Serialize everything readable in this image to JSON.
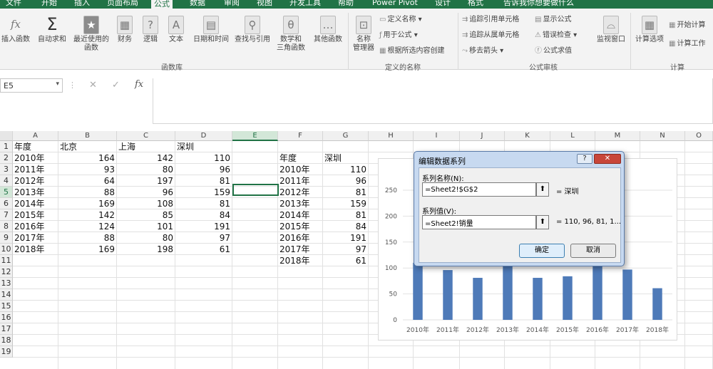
{
  "ribbon_tabs": [
    "文件",
    "开始",
    "插入",
    "页面布局",
    "公式",
    "数据",
    "审阅",
    "视图",
    "开发工具",
    "帮助",
    "Power Pivot",
    "设计",
    "格式",
    "告诉我你想要做什么"
  ],
  "ribbon": {
    "insert_function": "插入函数",
    "autosum": "自动求和",
    "recent": "最近使用的",
    "recent2": "函数",
    "financial": "财务",
    "logical": "逻辑",
    "text": "文本",
    "datetime": "日期和时间",
    "lookup": "查找与引用",
    "math": "数学和",
    "math2": "三角函数",
    "more": "其他函数",
    "group_library": "函数库",
    "name_manager": "名称",
    "name_manager2": "管理器",
    "define_name": "定义名称",
    "use_in_formula": "用于公式",
    "create_from_sel": "根据所选内容创建",
    "group_names": "定义的名称",
    "trace_prec": "追踪引用单元格",
    "trace_dep": "追踪从属单元格",
    "remove_arrows": "移去箭头",
    "show_formulas": "显示公式",
    "error_check": "错误检查",
    "evaluate": "公式求值",
    "watch": "监视窗口",
    "group_audit": "公式审核",
    "calc_options": "计算选项",
    "calc_now": "开始计算",
    "calc_sheet": "计算工作",
    "group_calc": "计算"
  },
  "formula_bar": {
    "namebox": "E5",
    "fx": "fx",
    "cancel": "✕",
    "enter": "✓"
  },
  "columns": [
    "A",
    "B",
    "C",
    "D",
    "E",
    "F",
    "G",
    "H",
    "I",
    "J",
    "K",
    "L",
    "M",
    "N",
    "O"
  ],
  "rows": [
    "1",
    "2",
    "3",
    "4",
    "5",
    "6",
    "7",
    "8",
    "9",
    "10",
    "11",
    "12",
    "13",
    "14",
    "15",
    "16",
    "17",
    "18",
    "19"
  ],
  "table1": {
    "headers": [
      "年度",
      "北京",
      "上海",
      "深圳"
    ],
    "rows": [
      [
        "2010年",
        "164",
        "142",
        "110"
      ],
      [
        "2011年",
        "93",
        "80",
        "96"
      ],
      [
        "2012年",
        "64",
        "197",
        "81"
      ],
      [
        "2013年",
        "88",
        "96",
        "159"
      ],
      [
        "2014年",
        "169",
        "108",
        "81"
      ],
      [
        "2015年",
        "142",
        "85",
        "84"
      ],
      [
        "2016年",
        "124",
        "101",
        "191"
      ],
      [
        "2017年",
        "88",
        "80",
        "97"
      ],
      [
        "2018年",
        "169",
        "198",
        "61"
      ]
    ]
  },
  "table2": {
    "headers": [
      "年度",
      "深圳"
    ],
    "rows": [
      [
        "2010年",
        "110"
      ],
      [
        "2011年",
        "96"
      ],
      [
        "2012年",
        "81"
      ],
      [
        "2013年",
        "159"
      ],
      [
        "2014年",
        "81"
      ],
      [
        "2015年",
        "84"
      ],
      [
        "2016年",
        "191"
      ],
      [
        "2017年",
        "97"
      ],
      [
        "2018年",
        "61"
      ]
    ]
  },
  "chart_data": {
    "type": "bar",
    "categories": [
      "2010年",
      "2011年",
      "2012年",
      "2013年",
      "2014年",
      "2015年",
      "2016年",
      "2017年",
      "2018年"
    ],
    "series": [
      {
        "name": "深圳",
        "values": [
          110,
          96,
          81,
          159,
          81,
          84,
          191,
          97,
          61
        ]
      }
    ],
    "yticks": [
      "0",
      "50",
      "100",
      "150",
      "200",
      "250"
    ],
    "ylim": [
      0,
      250
    ],
    "bar_color": "#4e7ab8"
  },
  "dialog": {
    "title": "编辑数据系列",
    "help": "?",
    "close": "✕",
    "name_label": "系列名称(N):",
    "name_value": "=Sheet2!$G$2",
    "name_preview": "= 深圳",
    "values_label": "系列值(V):",
    "values_value": "=Sheet2!销量",
    "values_preview": "= 110, 96, 81, 1...",
    "ok": "确定",
    "cancel": "取消"
  }
}
